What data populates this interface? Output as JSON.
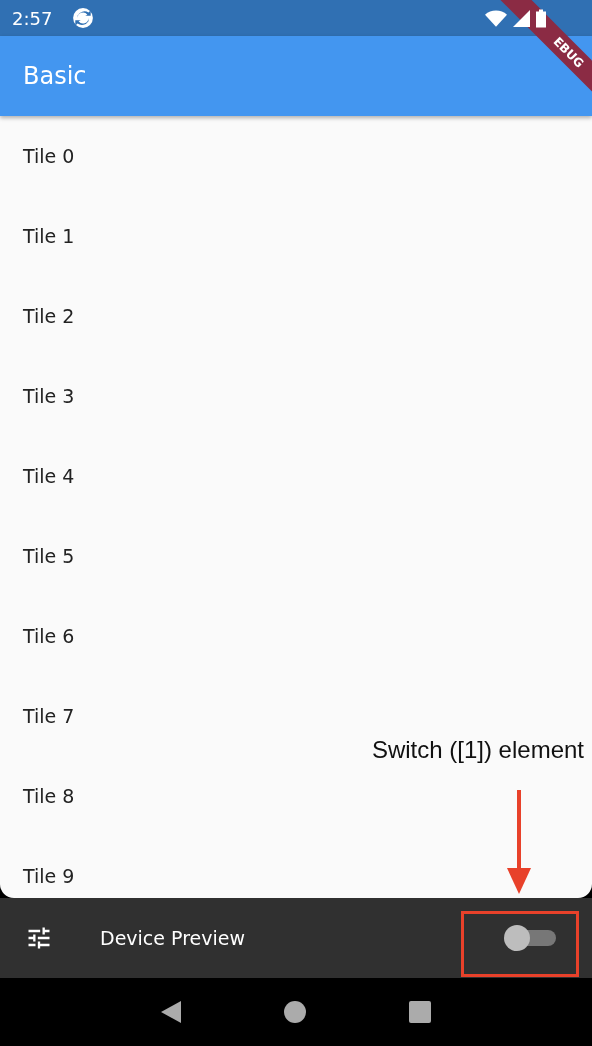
{
  "status_bar": {
    "time": "2:57"
  },
  "debug_banner": "EBUG",
  "app_bar": {
    "title": "Basic"
  },
  "tiles": [
    "Tile 0",
    "Tile 1",
    "Tile 2",
    "Tile 3",
    "Tile 4",
    "Tile 5",
    "Tile 6",
    "Tile 7",
    "Tile 8",
    "Tile 9"
  ],
  "bottom_bar": {
    "title": "Device Preview",
    "switch": {
      "on": false
    }
  },
  "annotation": {
    "label": "Switch ([1]) element"
  }
}
